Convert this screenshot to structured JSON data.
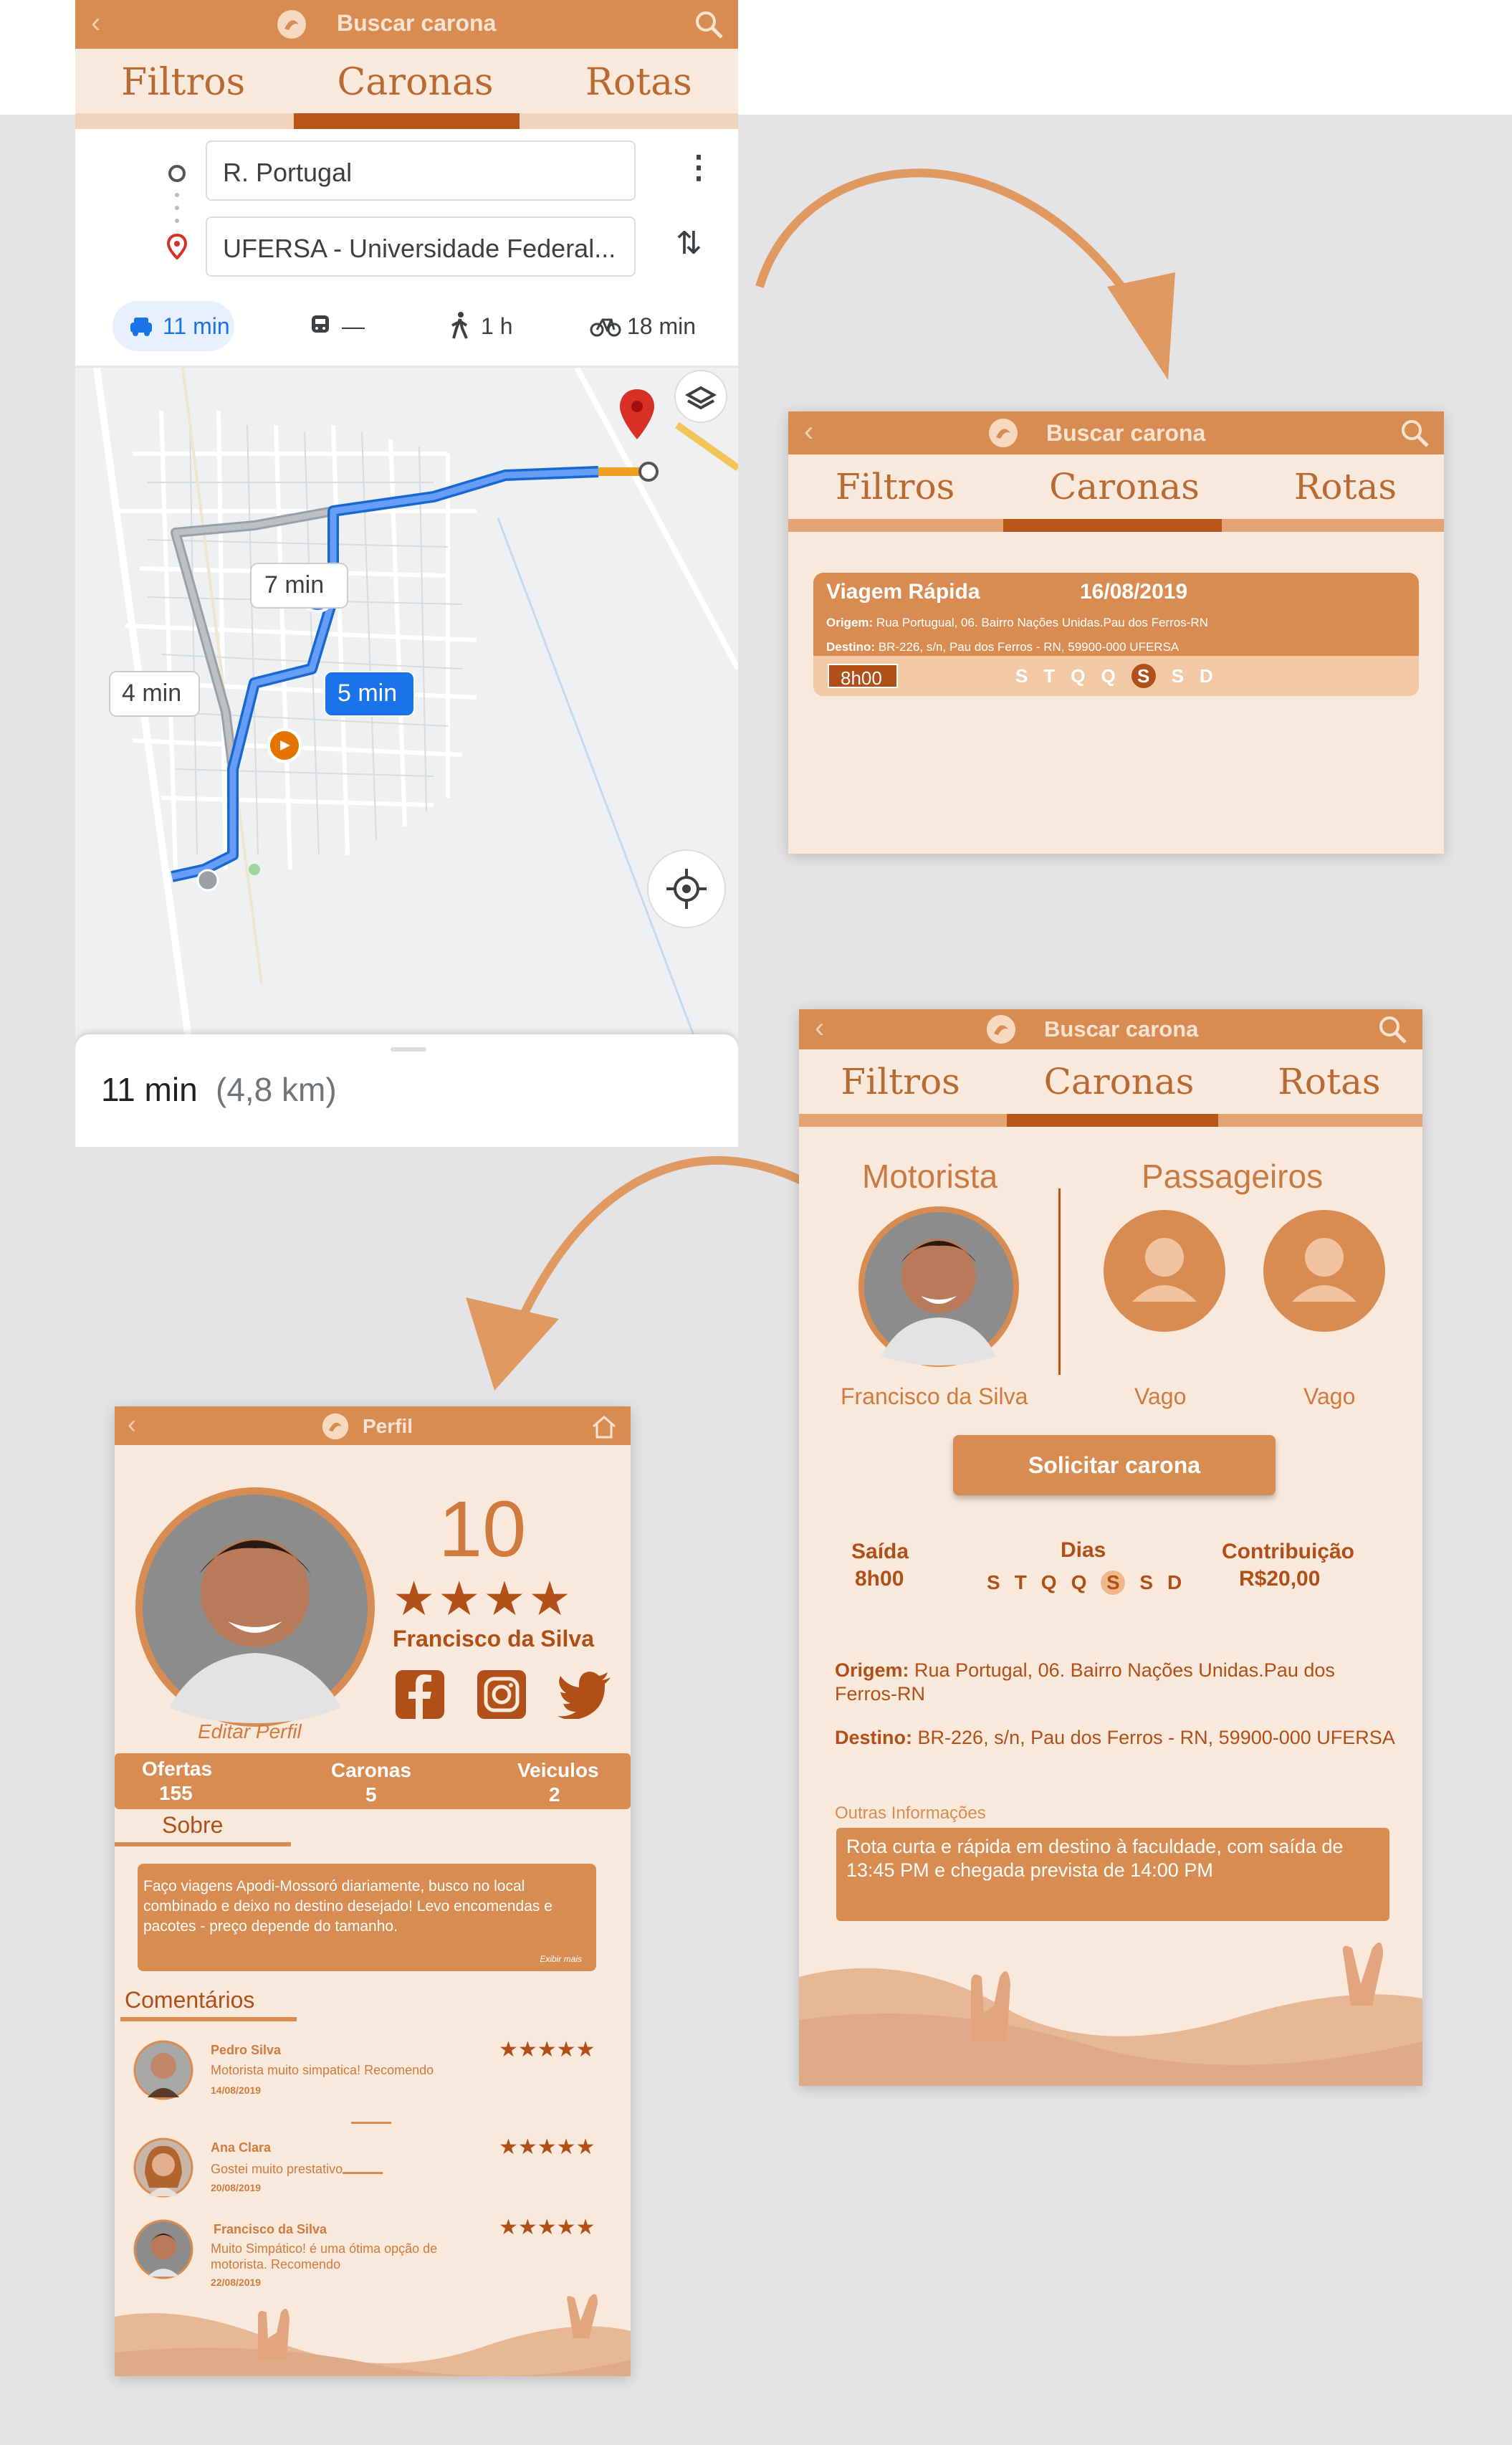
{
  "screen1": {
    "topbar_title": "Buscar carona",
    "tabs": [
      "Filtros",
      "Caronas",
      "Rotas"
    ],
    "origin": "R. Portugal",
    "destination": "UFERSA - Universidade Federal...",
    "modes": [
      {
        "icon": "car-icon",
        "label": "11 min"
      },
      {
        "icon": "train-icon",
        "label": "—"
      },
      {
        "icon": "walk-icon",
        "label": "1 h"
      },
      {
        "icon": "bike-icon",
        "label": "18 min"
      }
    ],
    "route_labels": [
      "7 min",
      "4 min",
      "5 min"
    ],
    "summary_time": "11 min",
    "summary_distance": "(4,8 km)"
  },
  "screen2": {
    "topbar_title": "Buscar carona",
    "tabs": [
      "Filtros",
      "Caronas",
      "Rotas"
    ],
    "card": {
      "title": "Viagem Rápida",
      "date": "16/08/2019",
      "origin_label": "Origem:",
      "origin": "Rua Portugual, 06. Bairro Nações Unidas.Pau dos Ferros-RN",
      "destination_label": "Destino:",
      "destination": "BR-226, s/n, Pau dos Ferros - RN, 59900-000 UFERSA",
      "time": "8h00",
      "days": [
        "S",
        "T",
        "Q",
        "Q",
        "S",
        "S",
        "D"
      ],
      "selected_day_index": 4
    }
  },
  "screen3": {
    "topbar_title": "Buscar carona",
    "tabs": [
      "Filtros",
      "Caronas",
      "Rotas"
    ],
    "driver_heading": "Motorista",
    "passengers_heading": "Passageiros",
    "driver_name": "Francisco da Silva",
    "passenger_labels": [
      "Vago",
      "Vago"
    ],
    "request_button": "Solicitar carona",
    "saida_label": "Saída",
    "saida_value": "8h00",
    "dias_label": "Dias",
    "days": [
      "S",
      "T",
      "Q",
      "Q",
      "S",
      "S",
      "D"
    ],
    "selected_day_index": 4,
    "contrib_label": "Contribuição",
    "contrib_value": "R$20,00",
    "origin_label": "Origem:",
    "origin": "Rua Portugal, 06. Bairro Nações Unidas.Pau dos Ferros-RN",
    "destination_label": "Destino:",
    "destination": "BR-226, s/n, Pau dos Ferros - RN, 59900-000 UFERSA",
    "other_info_label": "Outras Informações",
    "other_info": "Rota curta e rápida em destino à faculdade, com saída de 13:45 PM e chegada prevista de 14:00 PM"
  },
  "screen4": {
    "topbar_title": "Perfil",
    "score": "10",
    "stars": 4,
    "name": "Francisco da Silva",
    "edit_profile": "Editar Perfil",
    "stats": [
      {
        "label": "Ofertas",
        "value": "155"
      },
      {
        "label": "Caronas",
        "value": "5"
      },
      {
        "label": "Veiculos",
        "value": "2"
      }
    ],
    "about_heading": "Sobre",
    "about_text": "Faço viagens Apodi-Mossoró diariamente, busco no local combinado e deixo no destino desejado! Levo encomendas e pacotes - preço depende do tamanho.",
    "show_more": "Exibir mais",
    "comments_heading": "Comentários",
    "comments": [
      {
        "name": "Pedro Silva",
        "text": "Motorista muito simpatica! Recomendo",
        "date": "14/08/2019",
        "stars": 5
      },
      {
        "name": "Ana Clara",
        "text": "Gostei muito prestativo.",
        "date": "20/08/2019",
        "stars": 5
      },
      {
        "name": "Francisco da Silva",
        "text": "Muito Simpático! é uma ótima opção de motorista. Recomendo",
        "date": "22/08/2019",
        "stars": 5
      }
    ]
  },
  "colors": {
    "primary": "#d98c52",
    "primary_dark": "#b14f18",
    "background": "#f9e9dc",
    "map_route_blue": "#4285f4"
  }
}
